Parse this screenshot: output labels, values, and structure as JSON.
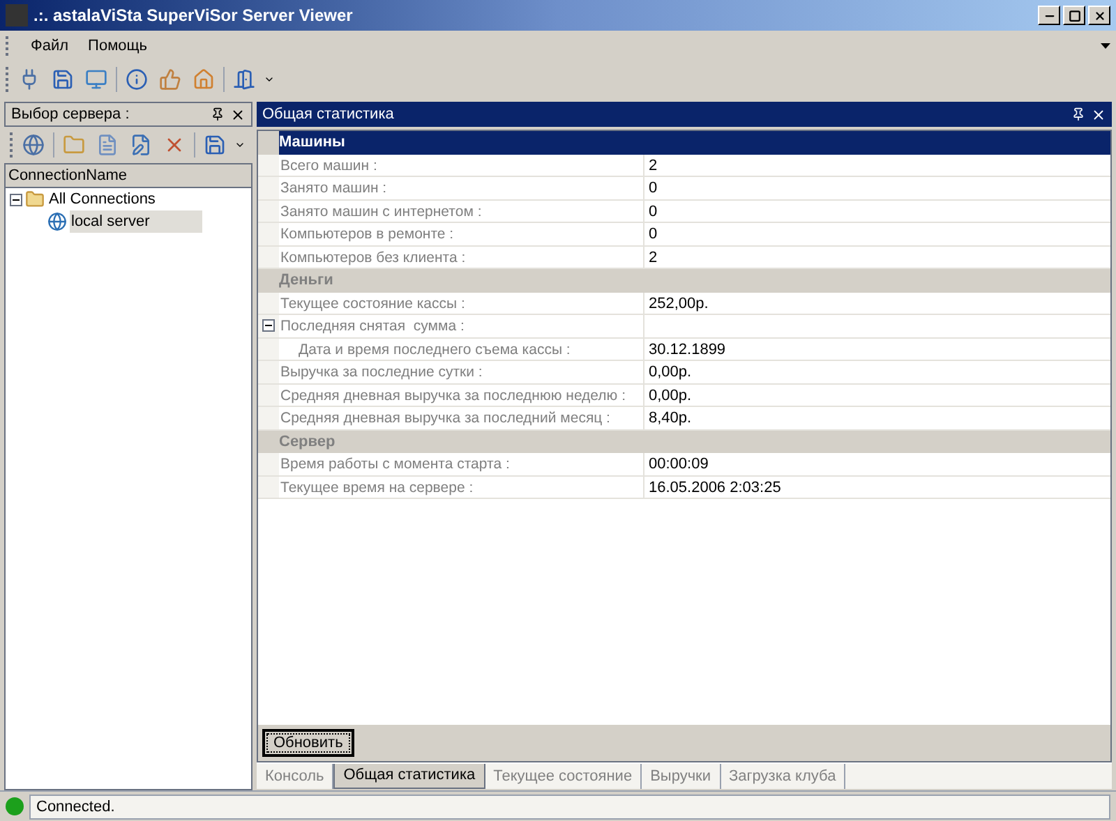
{
  "window": {
    "title": ".:. astalaViSta SuperViSor Server Viewer"
  },
  "menu": [
    "Файл",
    "Помощь"
  ],
  "left_panel": {
    "title": "Выбор сервера :",
    "column": "ConnectionName",
    "tree": [
      {
        "label": "All Connections",
        "expanded": true,
        "selected": false,
        "children": [
          {
            "label": "local server",
            "selected": true
          }
        ]
      }
    ]
  },
  "right_panel": {
    "title": "Общая статистика",
    "grid": [
      {
        "category": "Машины",
        "selected": true,
        "rows": [
          {
            "label": "Всего машин :",
            "value": "2"
          },
          {
            "label": "Занято машин :",
            "value": "0"
          },
          {
            "label": "Занято машин с интернетом :",
            "value": "0"
          },
          {
            "label": "Компьютеров в ремонте :",
            "value": "0"
          },
          {
            "label": "Компьютеров без клиента :",
            "value": "2"
          }
        ]
      },
      {
        "category": "Деньги",
        "selected": false,
        "rows": [
          {
            "label": "Текущее состояние кассы :",
            "value": "252,00р."
          },
          {
            "label": "Последняя снятая  сумма :",
            "expanded": true,
            "children": [
              {
                "label": "Дата и время последнего съема кассы :",
                "value": "30.12.1899"
              }
            ]
          },
          {
            "label": "Выручка за последние сутки :",
            "value": "0,00р."
          },
          {
            "label": "Средняя дневная выручка за последнюю неделю :",
            "value": "0,00р."
          },
          {
            "label": "Средняя дневная выручка за последний месяц :",
            "value": "8,40р."
          }
        ]
      },
      {
        "category": "Сервер",
        "selected": false,
        "rows": [
          {
            "label": "Время работы с момента старта :",
            "value": "00:00:09"
          },
          {
            "label": "Текущее время на сервере :",
            "value": "16.05.2006 2:03:25"
          }
        ]
      }
    ],
    "refresh_button": "Обновить",
    "tabs": [
      {
        "label": "Консоль",
        "selected": false
      },
      {
        "label": "Общая статистика",
        "selected": true
      },
      {
        "label": "Текущее состояние",
        "selected": false
      },
      {
        "label": "Выручки",
        "selected": false
      },
      {
        "label": "Загрузка клуба",
        "selected": false
      }
    ]
  },
  "status_bar": {
    "text": "Connected."
  }
}
